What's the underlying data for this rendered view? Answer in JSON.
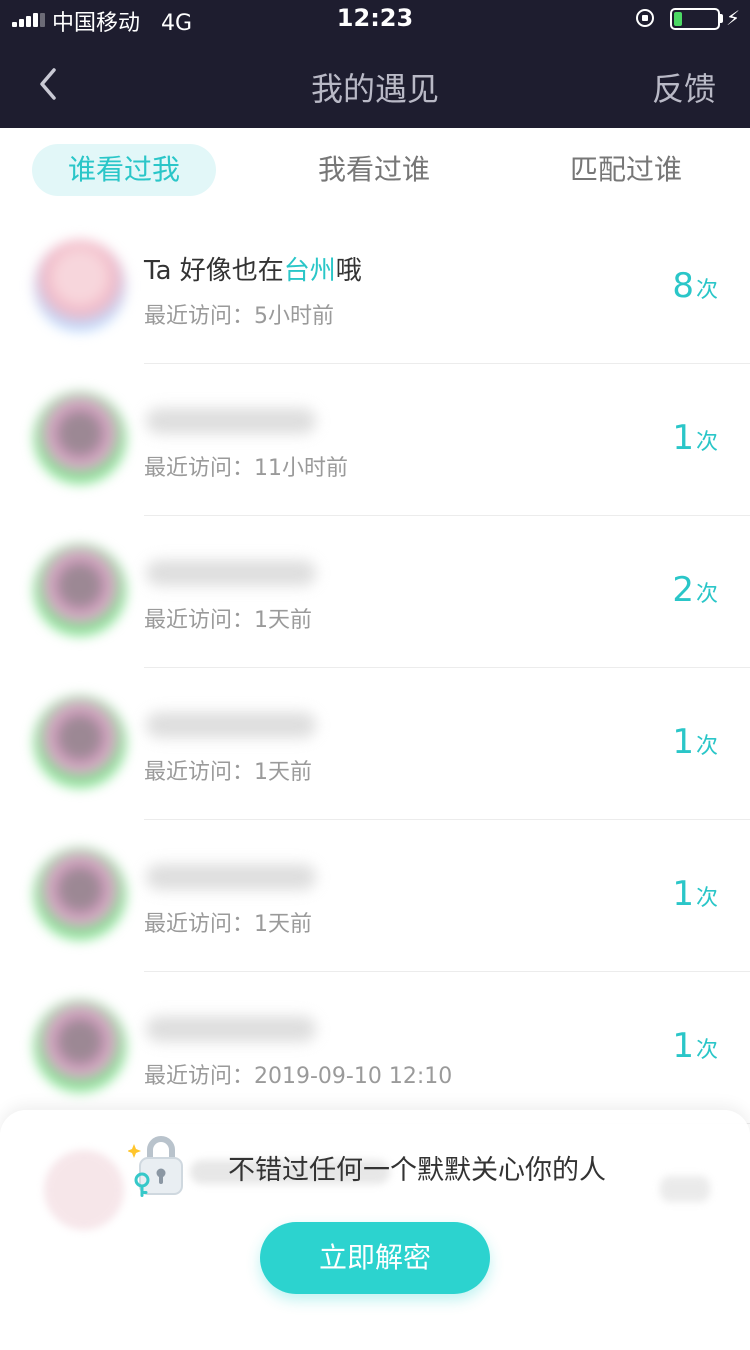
{
  "status_bar": {
    "carrier": "中国移动",
    "network": "4G",
    "time": "12:23",
    "battery_level": 0.2
  },
  "nav": {
    "title": "我的遇见",
    "right_action": "反馈"
  },
  "tabs": [
    {
      "label": "谁看过我",
      "active": true
    },
    {
      "label": "我看过谁",
      "active": false
    },
    {
      "label": "匹配过谁",
      "active": false
    }
  ],
  "visitors": [
    {
      "title_prefix": "Ta 好像也在",
      "title_city": "台州",
      "title_suffix": "哦",
      "visit": "最近访问：5小时前",
      "count": "8",
      "unit": "次"
    },
    {
      "visit": "最近访问：11小时前",
      "count": "1",
      "unit": "次"
    },
    {
      "visit": "最近访问：1天前",
      "count": "2",
      "unit": "次"
    },
    {
      "visit": "最近访问：1天前",
      "count": "1",
      "unit": "次"
    },
    {
      "visit": "最近访问：1天前",
      "count": "1",
      "unit": "次"
    },
    {
      "visit": "最近访问：2019-09-10 12:10",
      "count": "1",
      "unit": "次"
    }
  ],
  "unlock": {
    "message": "不错过任何一个默默关心你的人",
    "button": "立即解密",
    "icon": "lock-icon"
  },
  "colors": {
    "accent": "#2ac6c8",
    "header_bg": "#1e1d2f",
    "tab_active_bg": "#e2f7f8",
    "button_bg": "#2cd3cf"
  }
}
